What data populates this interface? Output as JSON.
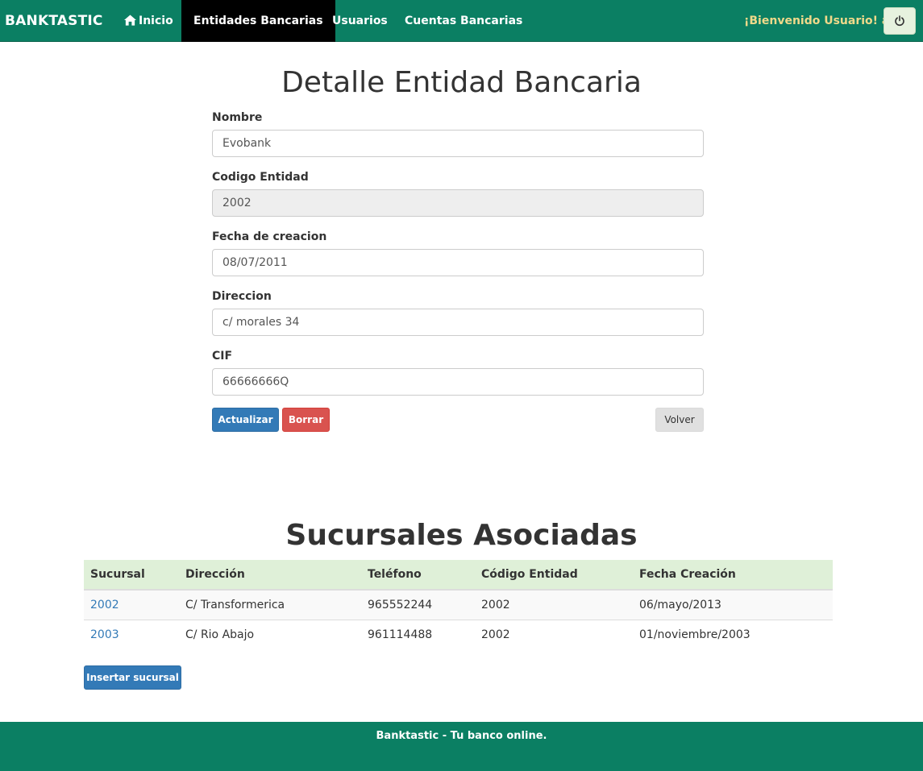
{
  "navbar": {
    "brand": "BANKTASTIC",
    "items": [
      {
        "label": "Inicio",
        "icon": "home-icon"
      },
      {
        "label": "Entidades Bancarias",
        "active": true
      },
      {
        "label": "Usuarios"
      },
      {
        "label": "Cuentas Bancarias"
      }
    ],
    "welcome": "¡Bienvenido Usuario! a",
    "logout_icon": "power-icon"
  },
  "form": {
    "title": "Detalle Entidad Bancaria",
    "fields": [
      {
        "label": "Nombre",
        "value": "Evobank",
        "readonly": false
      },
      {
        "label": "Codigo Entidad",
        "value": "2002",
        "readonly": true
      },
      {
        "label": "Fecha de creacion",
        "value": "08/07/2011",
        "readonly": false
      },
      {
        "label": "Direccion",
        "value": "c/ morales 34",
        "readonly": false
      },
      {
        "label": "CIF",
        "value": "66666666Q",
        "readonly": false
      }
    ],
    "buttons": {
      "update": "Actualizar",
      "delete": "Borrar",
      "back": "Volver"
    }
  },
  "branches": {
    "title": "Sucursales Asociadas",
    "columns": [
      "Sucursal",
      "Dirección",
      "Teléfono",
      "Código Entidad",
      "Fecha Creación"
    ],
    "rows": [
      [
        "2002",
        "C/ Transformerica",
        "965552244",
        "2002",
        "06/mayo/2013"
      ],
      [
        "2003",
        "C/ Rio Abajo",
        "961114488",
        "2002",
        "01/noviembre/2003"
      ]
    ],
    "insert_button": "Insertar sucursal"
  },
  "footer": {
    "text": "Banktastic - Tu banco online."
  },
  "colors": {
    "primary": "#0b7f63",
    "accent": "#337ab7",
    "danger": "#d9534f",
    "table_header": "#dff0d8"
  }
}
